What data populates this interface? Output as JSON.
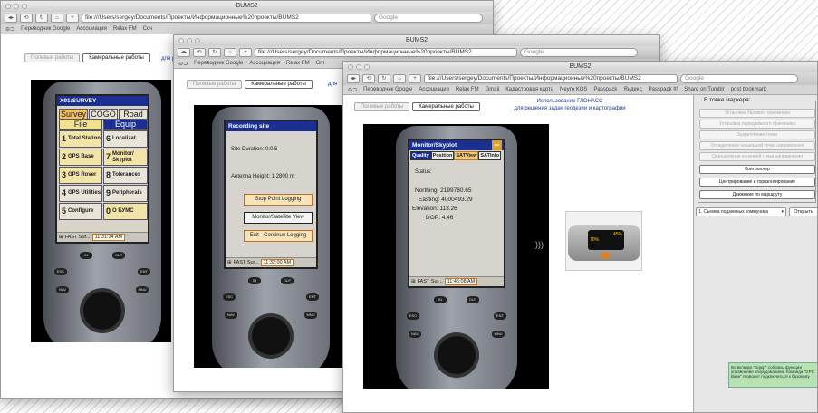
{
  "windows": [
    {
      "title": "BUMS2",
      "url": "file:///Users/sergey/Documents/Проекты/Информационные%20проекты/BUMS2",
      "search_placeholder": "Google",
      "bookmarks": [
        "Переводчик Google",
        "Ассоциация",
        "Relax FM",
        "Соч"
      ],
      "tabs": [
        "Полевые работы",
        "Камеральные работы"
      ],
      "truncated_heading": "для р",
      "device": {
        "app_title": "X91:SURVEY",
        "tabs_row1": [
          "Survey",
          "COGO",
          "Road"
        ],
        "tabs_row2": [
          "File",
          "Equip"
        ],
        "grid": [
          {
            "num": "1",
            "label": "Total Station"
          },
          {
            "num": "6",
            "label": "Localizat..."
          },
          {
            "num": "2",
            "label": "GPS Base"
          },
          {
            "num": "7",
            "label": "Monitor/ Skyplot"
          },
          {
            "num": "3",
            "label": "GPS Rover"
          },
          {
            "num": "8",
            "label": "Tolerances"
          },
          {
            "num": "4",
            "label": "GPS Utilities"
          },
          {
            "num": "9",
            "label": "Peripherals"
          },
          {
            "num": "5",
            "label": "Configure"
          },
          {
            "num": "0",
            "label": "О БУМС"
          }
        ],
        "taskbar": "FAST Sur...",
        "clock": "11:31:34 AM"
      }
    },
    {
      "title": "BUMS2",
      "url": "file:///Users/sergey/Documents/Проекты/Информационные%20проекты/BUMS2",
      "search_placeholder": "Google",
      "bookmarks": [
        "Переводчик Google",
        "Ассоциация",
        "Relax FM",
        "Gm"
      ],
      "tabs": [
        "Полевые работы",
        "Камеральные работы"
      ],
      "truncated_heading": "для",
      "device": {
        "app_title": "Recording site",
        "duration": "Site Duration:  0:0:5",
        "antenna": "Antenna Height:  1.2800 m",
        "buttons": [
          "Stop Point Logging",
          "Monitor/Satellite View",
          "Exit - Continue Logging"
        ],
        "taskbar": "FAST Sur...",
        "clock": "11:32:00 AM"
      }
    },
    {
      "title": "BUMS2",
      "url": "file:///Users/sergey/Documents/Проекты/Информационные%20проекты/BUMS2",
      "search_placeholder": "Google",
      "bookmarks": [
        "Переводчик Google",
        "Ассоциация",
        "Relax FM",
        "Gmail",
        "Кадастровая карта",
        "Neyro KOS",
        "Passpack",
        "Яндекс",
        "Passpack It!",
        "Share on Tumblr",
        "post bookmark"
      ],
      "tabs": [
        "Полевые работы",
        "Камеральные работы"
      ],
      "heading": [
        "Использование ГЛОНАСС",
        "для решения задач геодезии и картографии"
      ],
      "device": {
        "app_title": "Monitor/Skyplot",
        "tabs": [
          "Quality",
          "Position",
          "SATView",
          "SATInfo"
        ],
        "status": "Status:",
        "lines": [
          "Northing: 2199780.65",
          "Easting: 4000493.29",
          "Elevation: 113.26",
          "DOP: 4.46"
        ],
        "taskbar": "FAST Sur...",
        "clock": "11:45:08 AM"
      },
      "receiver": {
        "battery1": "45%",
        "battery2": "70%"
      },
      "panel": {
        "title": "В точке маркера:",
        "buttons": [
          "Установка базового приемника",
          "Установка передвижного приемника",
          "Закрепление точки",
          "Определение начальной точки направления",
          "Определение конечной точки направления",
          "Контроллер",
          "Центрирование и горизонтирование",
          "Движение по маршруту"
        ],
        "active": [
          5,
          6,
          7
        ],
        "select": "1. Съемка подземных коммуника",
        "open_button": "Открыть",
        "note": "Во вкладке \"Equip\" собраны функции управления оборудованием. Командa \"GPS Base\" позволит подключиться к базовому"
      }
    }
  ]
}
